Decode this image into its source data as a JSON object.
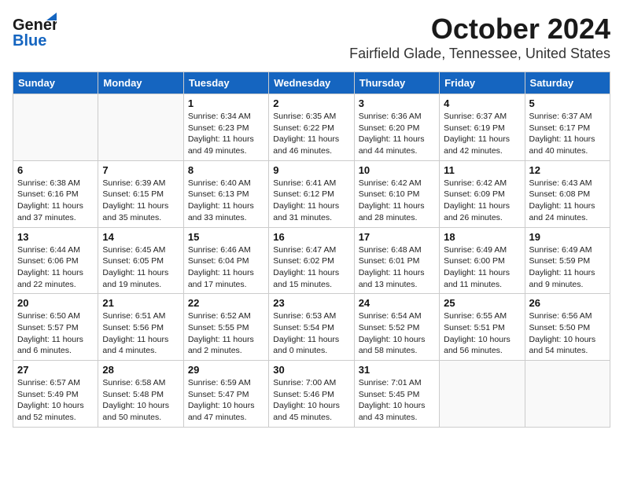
{
  "header": {
    "logo_general": "General",
    "logo_blue": "Blue",
    "title": "October 2024",
    "subtitle": "Fairfield Glade, Tennessee, United States"
  },
  "weekdays": [
    "Sunday",
    "Monday",
    "Tuesday",
    "Wednesday",
    "Thursday",
    "Friday",
    "Saturday"
  ],
  "weeks": [
    [
      {
        "day": "",
        "sunrise": "",
        "sunset": "",
        "daylight": ""
      },
      {
        "day": "",
        "sunrise": "",
        "sunset": "",
        "daylight": ""
      },
      {
        "day": "1",
        "sunrise": "Sunrise: 6:34 AM",
        "sunset": "Sunset: 6:23 PM",
        "daylight": "Daylight: 11 hours and 49 minutes."
      },
      {
        "day": "2",
        "sunrise": "Sunrise: 6:35 AM",
        "sunset": "Sunset: 6:22 PM",
        "daylight": "Daylight: 11 hours and 46 minutes."
      },
      {
        "day": "3",
        "sunrise": "Sunrise: 6:36 AM",
        "sunset": "Sunset: 6:20 PM",
        "daylight": "Daylight: 11 hours and 44 minutes."
      },
      {
        "day": "4",
        "sunrise": "Sunrise: 6:37 AM",
        "sunset": "Sunset: 6:19 PM",
        "daylight": "Daylight: 11 hours and 42 minutes."
      },
      {
        "day": "5",
        "sunrise": "Sunrise: 6:37 AM",
        "sunset": "Sunset: 6:17 PM",
        "daylight": "Daylight: 11 hours and 40 minutes."
      }
    ],
    [
      {
        "day": "6",
        "sunrise": "Sunrise: 6:38 AM",
        "sunset": "Sunset: 6:16 PM",
        "daylight": "Daylight: 11 hours and 37 minutes."
      },
      {
        "day": "7",
        "sunrise": "Sunrise: 6:39 AM",
        "sunset": "Sunset: 6:15 PM",
        "daylight": "Daylight: 11 hours and 35 minutes."
      },
      {
        "day": "8",
        "sunrise": "Sunrise: 6:40 AM",
        "sunset": "Sunset: 6:13 PM",
        "daylight": "Daylight: 11 hours and 33 minutes."
      },
      {
        "day": "9",
        "sunrise": "Sunrise: 6:41 AM",
        "sunset": "Sunset: 6:12 PM",
        "daylight": "Daylight: 11 hours and 31 minutes."
      },
      {
        "day": "10",
        "sunrise": "Sunrise: 6:42 AM",
        "sunset": "Sunset: 6:10 PM",
        "daylight": "Daylight: 11 hours and 28 minutes."
      },
      {
        "day": "11",
        "sunrise": "Sunrise: 6:42 AM",
        "sunset": "Sunset: 6:09 PM",
        "daylight": "Daylight: 11 hours and 26 minutes."
      },
      {
        "day": "12",
        "sunrise": "Sunrise: 6:43 AM",
        "sunset": "Sunset: 6:08 PM",
        "daylight": "Daylight: 11 hours and 24 minutes."
      }
    ],
    [
      {
        "day": "13",
        "sunrise": "Sunrise: 6:44 AM",
        "sunset": "Sunset: 6:06 PM",
        "daylight": "Daylight: 11 hours and 22 minutes."
      },
      {
        "day": "14",
        "sunrise": "Sunrise: 6:45 AM",
        "sunset": "Sunset: 6:05 PM",
        "daylight": "Daylight: 11 hours and 19 minutes."
      },
      {
        "day": "15",
        "sunrise": "Sunrise: 6:46 AM",
        "sunset": "Sunset: 6:04 PM",
        "daylight": "Daylight: 11 hours and 17 minutes."
      },
      {
        "day": "16",
        "sunrise": "Sunrise: 6:47 AM",
        "sunset": "Sunset: 6:02 PM",
        "daylight": "Daylight: 11 hours and 15 minutes."
      },
      {
        "day": "17",
        "sunrise": "Sunrise: 6:48 AM",
        "sunset": "Sunset: 6:01 PM",
        "daylight": "Daylight: 11 hours and 13 minutes."
      },
      {
        "day": "18",
        "sunrise": "Sunrise: 6:49 AM",
        "sunset": "Sunset: 6:00 PM",
        "daylight": "Daylight: 11 hours and 11 minutes."
      },
      {
        "day": "19",
        "sunrise": "Sunrise: 6:49 AM",
        "sunset": "Sunset: 5:59 PM",
        "daylight": "Daylight: 11 hours and 9 minutes."
      }
    ],
    [
      {
        "day": "20",
        "sunrise": "Sunrise: 6:50 AM",
        "sunset": "Sunset: 5:57 PM",
        "daylight": "Daylight: 11 hours and 6 minutes."
      },
      {
        "day": "21",
        "sunrise": "Sunrise: 6:51 AM",
        "sunset": "Sunset: 5:56 PM",
        "daylight": "Daylight: 11 hours and 4 minutes."
      },
      {
        "day": "22",
        "sunrise": "Sunrise: 6:52 AM",
        "sunset": "Sunset: 5:55 PM",
        "daylight": "Daylight: 11 hours and 2 minutes."
      },
      {
        "day": "23",
        "sunrise": "Sunrise: 6:53 AM",
        "sunset": "Sunset: 5:54 PM",
        "daylight": "Daylight: 11 hours and 0 minutes."
      },
      {
        "day": "24",
        "sunrise": "Sunrise: 6:54 AM",
        "sunset": "Sunset: 5:52 PM",
        "daylight": "Daylight: 10 hours and 58 minutes."
      },
      {
        "day": "25",
        "sunrise": "Sunrise: 6:55 AM",
        "sunset": "Sunset: 5:51 PM",
        "daylight": "Daylight: 10 hours and 56 minutes."
      },
      {
        "day": "26",
        "sunrise": "Sunrise: 6:56 AM",
        "sunset": "Sunset: 5:50 PM",
        "daylight": "Daylight: 10 hours and 54 minutes."
      }
    ],
    [
      {
        "day": "27",
        "sunrise": "Sunrise: 6:57 AM",
        "sunset": "Sunset: 5:49 PM",
        "daylight": "Daylight: 10 hours and 52 minutes."
      },
      {
        "day": "28",
        "sunrise": "Sunrise: 6:58 AM",
        "sunset": "Sunset: 5:48 PM",
        "daylight": "Daylight: 10 hours and 50 minutes."
      },
      {
        "day": "29",
        "sunrise": "Sunrise: 6:59 AM",
        "sunset": "Sunset: 5:47 PM",
        "daylight": "Daylight: 10 hours and 47 minutes."
      },
      {
        "day": "30",
        "sunrise": "Sunrise: 7:00 AM",
        "sunset": "Sunset: 5:46 PM",
        "daylight": "Daylight: 10 hours and 45 minutes."
      },
      {
        "day": "31",
        "sunrise": "Sunrise: 7:01 AM",
        "sunset": "Sunset: 5:45 PM",
        "daylight": "Daylight: 10 hours and 43 minutes."
      },
      {
        "day": "",
        "sunrise": "",
        "sunset": "",
        "daylight": ""
      },
      {
        "day": "",
        "sunrise": "",
        "sunset": "",
        "daylight": ""
      }
    ]
  ]
}
